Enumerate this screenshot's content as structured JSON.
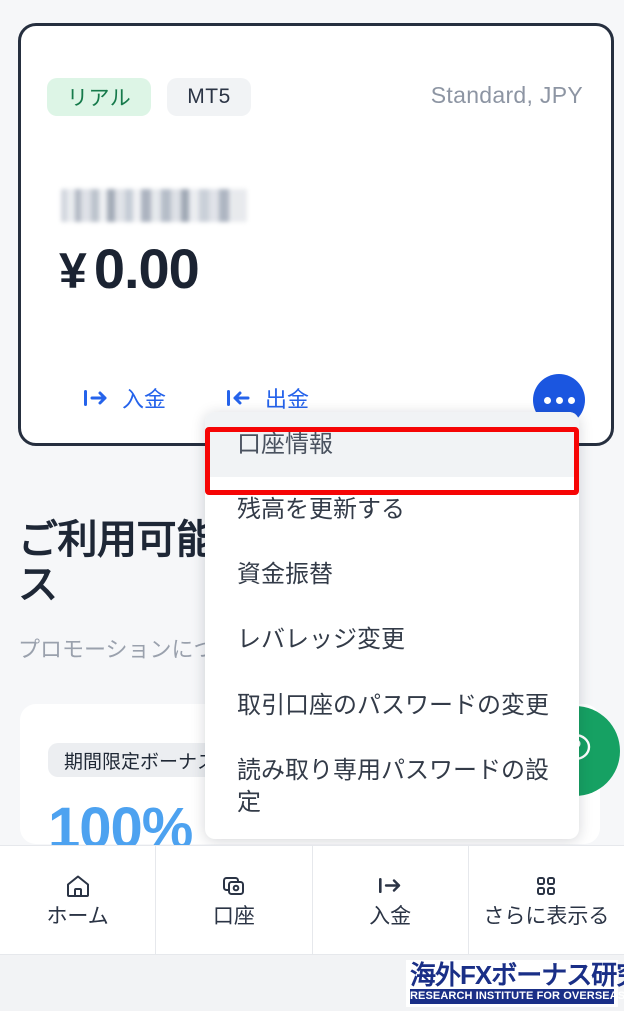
{
  "account_card": {
    "badges": [
      {
        "label": "リアル",
        "kind": "real"
      },
      {
        "label": "MT5",
        "kind": "platform"
      }
    ],
    "account_type": "Standard, JPY",
    "masked_account_id": "",
    "balance_currency": "¥",
    "balance_value": "0.00",
    "actions": [
      {
        "label": "入金",
        "icon": "deposit-arrow-icon"
      },
      {
        "label": "出金",
        "icon": "withdraw-arrow-icon"
      }
    ],
    "more_button_icon": "ellipsis-icon"
  },
  "context_menu": {
    "items": [
      {
        "label": "口座情報",
        "highlighted": true
      },
      {
        "label": "残高を更新する",
        "highlighted": false
      },
      {
        "label": "資金振替",
        "highlighted": false
      },
      {
        "label": "レバレッジ変更",
        "highlighted": false
      },
      {
        "label": "取引口座のパスワードの変更",
        "highlighted": false
      },
      {
        "label": "読み取り専用パスワードの設定",
        "highlighted": false
      }
    ],
    "highlight_color": "#f60505"
  },
  "page_background": {
    "heading": "ご利用可能なボーナ\nス",
    "subheading": "プロモーションについての詳細はこちら！",
    "bonus_card": {
      "chip": "期間限定ボーナス",
      "percent": "100%"
    }
  },
  "help": {
    "icon": "help-chat-icon",
    "color": "#16a163"
  },
  "bottom_nav": {
    "items": [
      {
        "label": "ホーム",
        "icon": "home-icon"
      },
      {
        "label": "口座",
        "icon": "accounts-icon"
      },
      {
        "label": "入金",
        "icon": "deposit-arrow-icon"
      },
      {
        "label": "さらに表示る",
        "icon": "grid-more-icon"
      }
    ]
  },
  "watermark": {
    "main": "海外FXボーナス研究所",
    "sub": "RESEARCH INSTITUTE FOR OVERSEASFX BONUS",
    "color": "#1a2f87"
  }
}
